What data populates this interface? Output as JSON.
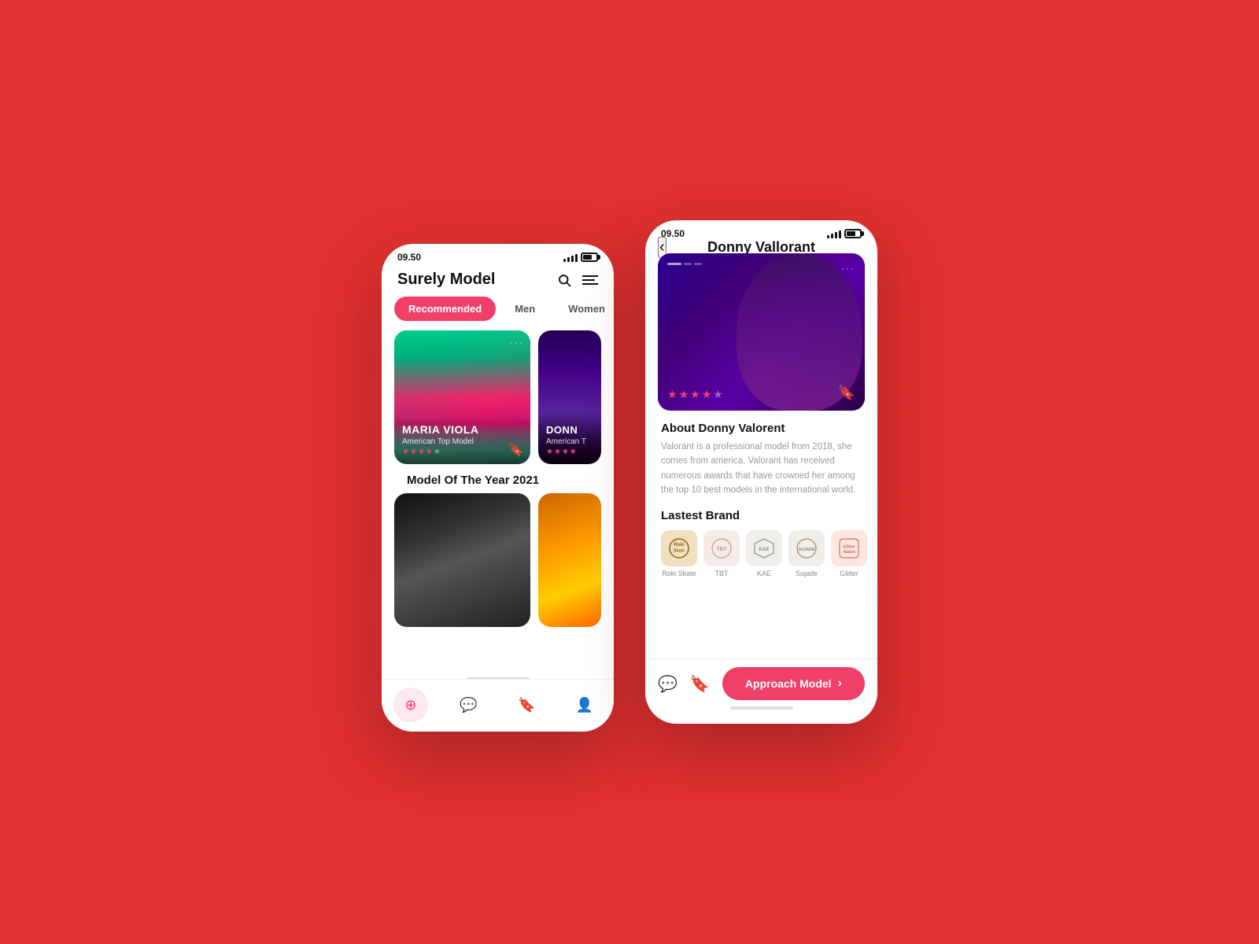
{
  "background": "#e03030",
  "phone1": {
    "status_time": "09.50",
    "app_title": "Surely Model",
    "tabs": [
      {
        "label": "Recommended",
        "active": true
      },
      {
        "label": "Men",
        "active": false
      },
      {
        "label": "Women",
        "active": false
      }
    ],
    "cards": [
      {
        "name": "MARIA VIOLA",
        "subtitle": "American Top Model",
        "stars": 4,
        "total_stars": 5
      },
      {
        "name": "DONN",
        "subtitle": "American T",
        "stars": 4,
        "total_stars": 5
      }
    ],
    "section_title": "Model Of The Year 2021",
    "bottom_cards": [
      {
        "type": "dark"
      },
      {
        "type": "warm"
      }
    ]
  },
  "phone2": {
    "status_time": "09.50",
    "model_name": "Donny Vallorant",
    "about_title": "About Donny Valorent",
    "about_text": "Valorant is a professional model from 2018, she comes from america. Valorant has received numerous awards that have crowned her among the top 10 best models in the international world.",
    "brands_title": "Lastest Brand",
    "brands": [
      {
        "name": "Roki Skate",
        "short": "Roki\nSkate"
      },
      {
        "name": "TBT",
        "short": "TBT"
      },
      {
        "name": "KAE",
        "short": "KAE"
      },
      {
        "name": "Sujade",
        "short": "SUJADE"
      },
      {
        "name": "Gliiter",
        "short": "Glitter\n•Salon"
      }
    ],
    "approach_label": "Approach Model",
    "stars": 4,
    "total_stars": 5
  }
}
